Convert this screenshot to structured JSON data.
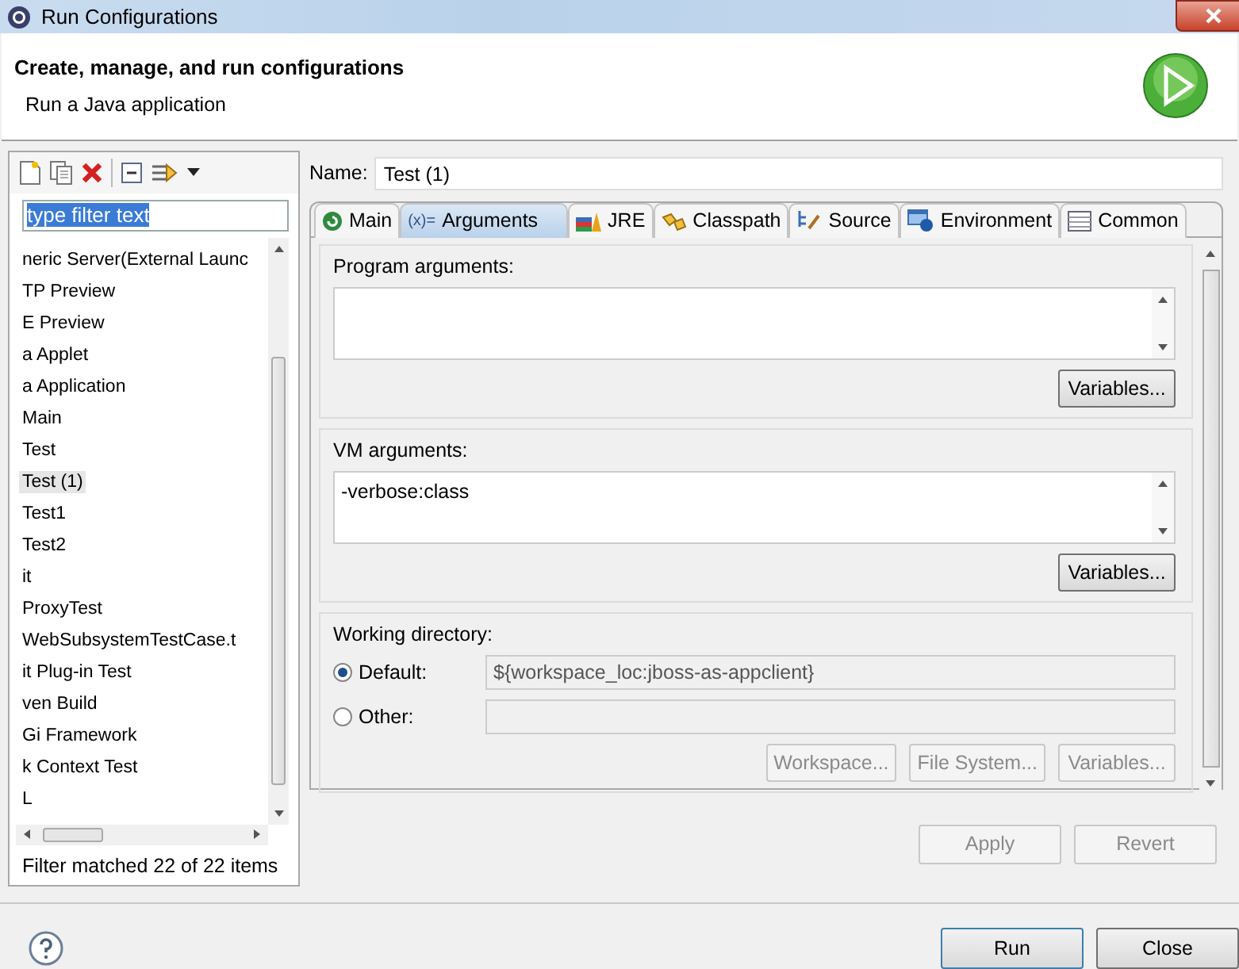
{
  "window": {
    "title": "Run Configurations"
  },
  "header": {
    "title": "Create, manage, and run configurations",
    "subtitle": "Run a Java application"
  },
  "sidebar": {
    "filter": {
      "value": "type filter text",
      "highlighted": true
    },
    "items": [
      {
        "label": "neric Server(External Launc",
        "selected": false
      },
      {
        "label": "TP Preview",
        "selected": false
      },
      {
        "label": "E Preview",
        "selected": false
      },
      {
        "label": "a Applet",
        "selected": false
      },
      {
        "label": "a Application",
        "selected": false
      },
      {
        "label": "Main",
        "selected": false
      },
      {
        "label": "Test",
        "selected": false
      },
      {
        "label": "Test (1)",
        "selected": true
      },
      {
        "label": "Test1",
        "selected": false
      },
      {
        "label": "Test2",
        "selected": false
      },
      {
        "label": "it",
        "selected": false
      },
      {
        "label": "ProxyTest",
        "selected": false
      },
      {
        "label": "WebSubsystemTestCase.t",
        "selected": false
      },
      {
        "label": "it Plug-in Test",
        "selected": false
      },
      {
        "label": "ven Build",
        "selected": false
      },
      {
        "label": "Gi Framework",
        "selected": false
      },
      {
        "label": "k Context Test",
        "selected": false
      },
      {
        "label": "L",
        "selected": false
      }
    ],
    "status": "Filter matched 22 of 22 items"
  },
  "name_field": {
    "label": "Name:",
    "value": "Test (1)"
  },
  "tabs": [
    {
      "label": "Main",
      "kind": "main",
      "selected": false
    },
    {
      "label": "Arguments",
      "kind": "arguments",
      "icon_text": "(x)=",
      "selected": true
    },
    {
      "label": "JRE",
      "kind": "jre",
      "selected": false
    },
    {
      "label": "Classpath",
      "kind": "classpath",
      "selected": false
    },
    {
      "label": "Source",
      "kind": "source",
      "selected": false
    },
    {
      "label": "Environment",
      "kind": "environment",
      "selected": false
    },
    {
      "label": "Common",
      "kind": "common",
      "selected": false
    }
  ],
  "argument_groups": [
    {
      "title": "Program arguments:",
      "button": "Variables..."
    },
    {
      "title": "VM arguments:",
      "value": "-verbose:class",
      "button": "Variables..."
    }
  ],
  "working_directory": {
    "title": "Working directory:",
    "options": [
      {
        "label": "Default:",
        "selected": true,
        "disabled": true,
        "value": "${workspace_loc:jboss-as-appclient}"
      },
      {
        "label": "Other:",
        "selected": false,
        "disabled": true
      }
    ],
    "buttons": [
      {
        "label": "Workspace...",
        "disabled": true
      },
      {
        "label": "File System...",
        "disabled": true
      },
      {
        "label": "Variables...",
        "disabled": true
      }
    ]
  },
  "actions": [
    {
      "label": "Apply",
      "disabled": true
    },
    {
      "label": "Revert",
      "disabled": true
    }
  ],
  "footer_buttons": [
    {
      "label": "Run",
      "default": true
    },
    {
      "label": "Close",
      "default": false
    }
  ]
}
